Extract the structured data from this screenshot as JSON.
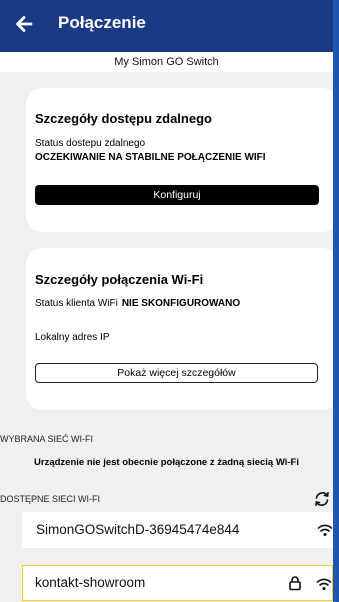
{
  "header": {
    "title": "Połączenie",
    "icon": "arrow-left-icon",
    "background": "#1b3a84"
  },
  "device": {
    "name": "My Simon GO Switch"
  },
  "remote_card": {
    "title": "Szczegóły dostępu zdalnego",
    "status_label": "Status dostepu zdalnego",
    "status_value": "OCZEKIWANIE NA STABILNE POŁĄCZENIE WIFI",
    "button_label": "Konfiguruj"
  },
  "wifi_card": {
    "title": "Szczegóły połączenia Wi-Fi",
    "status_label": "Status klienta WiFi",
    "status_value": "NIE SKONFIGUROWANO",
    "ip_label": "Lokalny adres IP",
    "button_label": "Pokaż więcej szczegółów"
  },
  "selected_network": {
    "section_label": "WYBRANA SIEĆ WI-FI",
    "notice": "Urządzenie nie jest obecnie połączone z żadną siecią Wi-Fi"
  },
  "available_networks": {
    "section_label": "DOSTĘPNE SIECI WI-FI",
    "refresh_icon": "refresh-icon",
    "items": [
      {
        "name": "SimonGOSwitchD-36945474e844",
        "secured": false,
        "icon": "wifi-icon"
      },
      {
        "name": "kontakt-showroom",
        "secured": true,
        "icon": "wifi-icon",
        "lock_icon": "lock-icon"
      }
    ]
  },
  "colors": {
    "accent_blue": "#1b3a84",
    "background": "#f0f0f0",
    "highlight_border": "#f2d21e"
  }
}
